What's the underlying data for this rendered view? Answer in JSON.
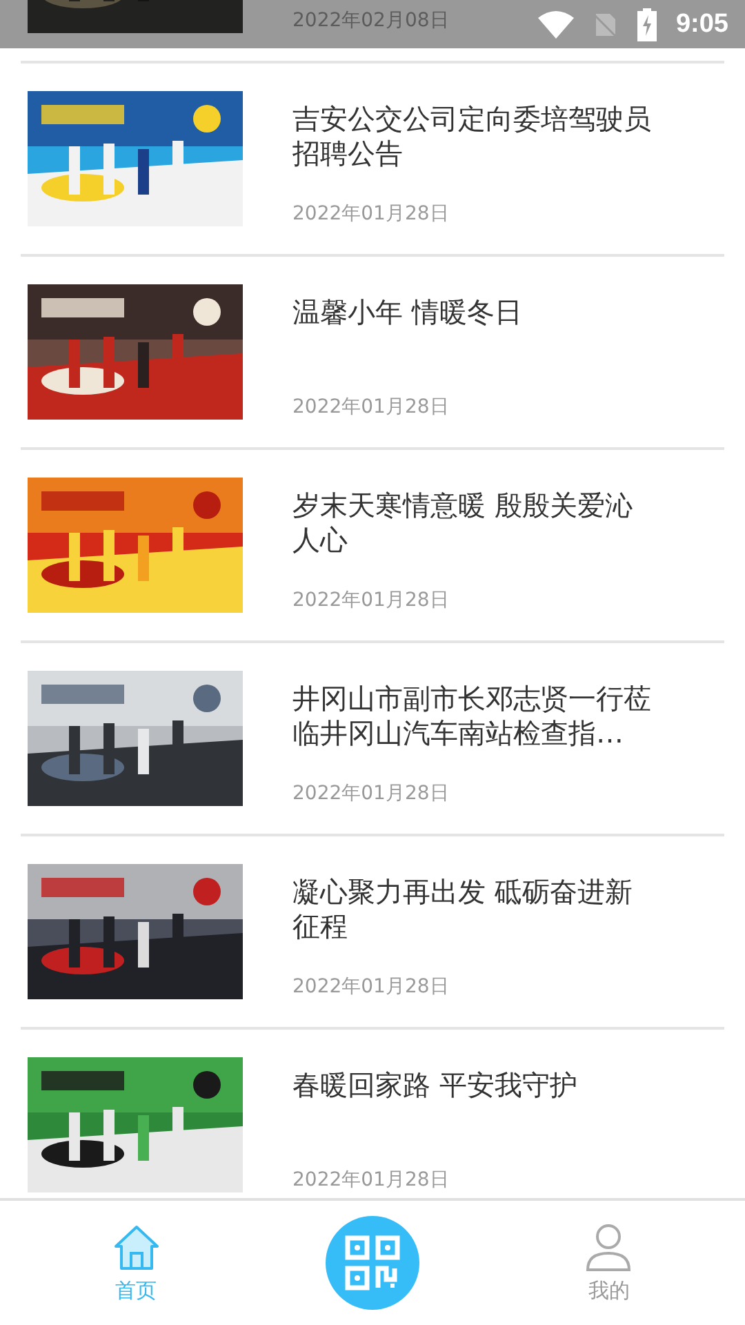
{
  "status_bar": {
    "time": "9:05"
  },
  "news": [
    {
      "date": "2022年02月08日"
    },
    {
      "title": "吉安公交公司定向委培驾驶员招聘公告",
      "date": "2022年01月28日"
    },
    {
      "title": "温馨小年 情暖冬日",
      "date": "2022年01月28日"
    },
    {
      "title": "岁末天寒情意暖 殷殷关爱沁人心",
      "date": "2022年01月28日"
    },
    {
      "title": "井冈山市副市长邓志贤一行莅临井冈山汽车南站检查指…",
      "date": "2022年01月28日"
    },
    {
      "title": "凝心聚力再出发 砥砺奋进新征程",
      "date": "2022年01月28日"
    },
    {
      "title": "春暖回家路 平安我守护",
      "date": "2022年01月28日"
    }
  ],
  "bottom_nav": [
    {
      "kind": "home",
      "label": "首页",
      "selected": true
    },
    {
      "kind": "scan"
    },
    {
      "kind": "profile",
      "label": "我的",
      "selected": false
    }
  ]
}
